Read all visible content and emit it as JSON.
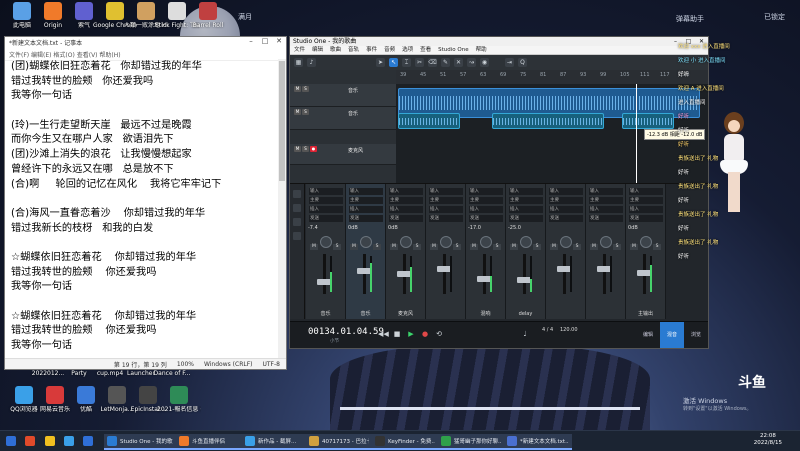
{
  "desktop": {
    "icons": [
      {
        "label": "此电脑",
        "color": "#5aa0e6"
      },
      {
        "label": "Origin",
        "color": "#f07a2a"
      },
      {
        "label": "索气",
        "color": "#6060d0"
      },
      {
        "label": "Google Chrome",
        "color": "#e0c030"
      },
      {
        "label": "人類一败涂地 Human Fal...",
        "color": "#d0a060"
      },
      {
        "label": "Stick Fight: The Game",
        "color": "#dddddd"
      },
      {
        "label": "Barrel Roll",
        "color": "#c04040"
      }
    ],
    "bottom_icons": [
      {
        "label": "QQ浏览器",
        "color": "#3aa0e8"
      },
      {
        "label": "网易云音乐",
        "color": "#d83a3a"
      },
      {
        "label": "优酷",
        "color": "#3a7ad8"
      },
      {
        "label": "LetMonja...",
        "color": "#555555"
      },
      {
        "label": "EpicInstal...",
        "color": "#444444"
      },
      {
        "label": "2021-報名信息 (1).xlsx",
        "color": "#2e8b57"
      }
    ],
    "mid_icons": [
      {
        "label": "2022012...",
        "color": "#d7a93a"
      },
      {
        "label": "Party",
        "color": "#8a6be0"
      },
      {
        "label": "cup.mp4",
        "color": "#444444"
      },
      {
        "label": "Launcher",
        "color": "#555555"
      },
      {
        "label": "Dance of F...",
        "color": "#8a3a3a"
      }
    ],
    "watermark_top_left": "满月",
    "top_right": [
      "弹幕助手",
      "已锁定"
    ],
    "activate": {
      "title": "激活 Windows",
      "sub": "转到\"设置\"以激活 Windows。"
    },
    "douyu_logo": "斗鱼"
  },
  "notepad": {
    "title": "*新建文本文档.txt - 记事本",
    "menu": "文件(F)  编辑(E)  格式(O)  查看(V)  帮助(H)",
    "lines": [
      "(团)蝴蝶依旧狂恋着花   你却错过我的年华",
      "错过我转世的脸颊   你还爱我吗",
      "我等你一句话",
      "",
      "(玲)一生行走望断天崖   最远不过是晚霞",
      "而你今生又在哪户人家   欲语泪先下",
      "(团)沙滩上消失的浪花   让我慢慢想起家",
      "曾经许下的永远又在哪   总是放不下",
      "(合)啊     轮回的记忆在风化    我将它牢牢记下",
      "",
      "(合)海风一直眷恋着沙    你却错过我的年华",
      "错过我新长的枝枒   和我的白发",
      "",
      "☆蝴蝶依旧狂恋着花    你却错过我的年华",
      "错过我转世的脸颊    你还爱我吗",
      "我等你一句话",
      "",
      "☆蝴蝶依旧狂恋着花    你却错过我的年华",
      "错过我转世的脸颊    你还爱我吗",
      "我等你一句话"
    ],
    "status": {
      "position": "第 19 行，第 19 列",
      "zoom": "100%",
      "eol": "Windows (CRLF)",
      "encoding": "UTF-8"
    }
  },
  "studio": {
    "title": "Studio One - 我的歌曲",
    "menu": [
      "文件",
      "编辑",
      "歌曲",
      "音轨",
      "事件",
      "音频",
      "选项",
      "查看",
      "Studio One",
      "帮助"
    ],
    "tracks": [
      {
        "name": "音乐",
        "color": "#2a7bd2"
      },
      {
        "name": "音乐",
        "color": "#2a7bd2"
      },
      {
        "name": "麦克风",
        "color": "#2fa4c9"
      }
    ],
    "ruler_labels": [
      "39",
      "45",
      "51",
      "57",
      "63",
      "69",
      "75",
      "81",
      "87",
      "93",
      "99",
      "105",
      "111",
      "117",
      "123"
    ],
    "tooltip": "-12.3 dB 相距 -12.0 dB",
    "mixer_strips": [
      {
        "name": "音乐",
        "value": "-7.4",
        "level": 0.55,
        "fader": 0.62
      },
      {
        "name": "音乐",
        "value": "0dB",
        "level": 0.8,
        "fader": 0.35
      },
      {
        "name": "麦克风",
        "value": "0dB",
        "level": 0.7,
        "fader": 0.42
      },
      {
        "name": "",
        "value": "",
        "level": 0.0,
        "fader": 0.3
      },
      {
        "name": "混响",
        "value": "-17.0",
        "level": 0.45,
        "fader": 0.55
      },
      {
        "name": "delay",
        "value": "-25.0",
        "level": 0.35,
        "fader": 0.58
      },
      {
        "name": "",
        "value": "",
        "level": 0.0,
        "fader": 0.3
      },
      {
        "name": "",
        "value": "",
        "level": 0.0,
        "fader": 0.3
      },
      {
        "name": "主输出",
        "value": "0dB",
        "level": 0.75,
        "fader": 0.4
      }
    ],
    "mixer_slots": {
      "input": "输入",
      "main": "主要",
      "insert": "插入",
      "send": "发送"
    },
    "transport": {
      "time": "00134.01.04.59",
      "time_sub": "小节",
      "tempo": "120.00",
      "signature": "4 / 4",
      "tabs": [
        "编辑",
        "混音",
        "浏览"
      ]
    }
  },
  "stream": {
    "chat": [
      {
        "text": "欢迎 xxx 进入直播间",
        "color": "#ffe27a"
      },
      {
        "text": "欢迎 小 进入直播间",
        "color": "#7fe3ff"
      },
      {
        "text": "好听",
        "color": "#ffffff"
      },
      {
        "text": "欢迎 A 进入直播间",
        "color": "#ffe27a"
      },
      {
        "text": "进入直播间",
        "color": "#ffffff"
      },
      {
        "text": "好听",
        "color": "#ff9ad8"
      },
      {
        "text": "好听",
        "color": "#ffffff"
      },
      {
        "text": "好听",
        "color": "#ffd36a"
      },
      {
        "text": "贵族送出了 礼物",
        "color": "#ffe27a"
      },
      {
        "text": "好听",
        "color": "#ffffff"
      },
      {
        "text": "贵族送出了 礼物",
        "color": "#ffe27a"
      },
      {
        "text": "好听",
        "color": "#ffffff"
      },
      {
        "text": "贵族送出了 礼物",
        "color": "#ffe27a"
      },
      {
        "text": "好听",
        "color": "#ffffff"
      },
      {
        "text": "贵族送出了 礼物",
        "color": "#ffe27a"
      },
      {
        "text": "好听",
        "color": "#ffffff"
      }
    ]
  },
  "taskbar": {
    "items": [
      {
        "label": "",
        "color": "#2f6fd6"
      },
      {
        "label": "",
        "color": "#e04a2a"
      },
      {
        "label": "",
        "color": "#f0c020"
      },
      {
        "label": "",
        "color": "#3aa0e8"
      },
      {
        "label": "",
        "color": "#2f6fd6"
      },
      {
        "label": "Studio One - 我的歌曲",
        "color": "#2a7bd2",
        "open": true
      },
      {
        "label": "斗鱼直播伴侣",
        "color": "#f07a2a",
        "open": true
      },
      {
        "label": "新作品 - 截屏...",
        "color": "#3aa0e8",
        "open": true
      },
      {
        "label": "40717173 - 巴拉卡...",
        "color": "#d0a040",
        "open": true
      },
      {
        "label": "KeyFinder - 免费...",
        "color": "#333333",
        "open": true
      },
      {
        "label": "猛哥幽子那你好聊...",
        "color": "#2fa04a",
        "open": true
      },
      {
        "label": "*新建文本文档.txt...",
        "color": "#4a6fd0",
        "open": true
      }
    ],
    "time": "22:08",
    "date": "2022/8/15"
  }
}
